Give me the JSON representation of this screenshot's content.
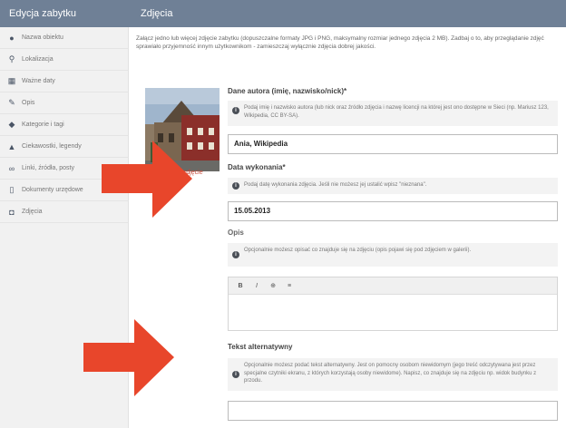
{
  "sidebar": {
    "title": "Edycja zabytku",
    "items": [
      {
        "label": "Nazwa obiektu",
        "icon": "circle-icon"
      },
      {
        "label": "Lokalizacja",
        "icon": "pin-icon"
      },
      {
        "label": "Ważne daty",
        "icon": "calendar-icon"
      },
      {
        "label": "Opis",
        "icon": "edit-icon"
      },
      {
        "label": "Kategorie i tagi",
        "icon": "tag-icon"
      },
      {
        "label": "Ciekawostki, legendy",
        "icon": "pointer-icon"
      },
      {
        "label": "Linki, źródła, posty",
        "icon": "link-icon"
      },
      {
        "label": "Dokumenty urzędowe",
        "icon": "document-icon"
      },
      {
        "label": "Zdjęcia",
        "icon": "camera-icon"
      }
    ]
  },
  "main": {
    "title": "Zdjęcia",
    "intro": "Załącz jedno lub więcej zdjęcie zabytku (dopuszczalne formaty JPG i PNG, maksymalny rozmiar jednego zdjęcia 2 MB). Zadbaj o to, aby przeglądanie zdjęć sprawiało przyjemność innym użytkownikom - zamieszczaj wyłącznie zdjęcia dobrej jakości.",
    "photo_link": "ń zdjęcie"
  },
  "form": {
    "author": {
      "label": "Dane autora (imię, nazwisko/nick)*",
      "hint": "Podaj imię i nazwisko autora (lub nick oraz źródło zdjęcia i nazwę licencji na której jest ono dostępne w Sieci (np. Mariusz 123, Wikipedia, CC BY-SA).",
      "value": "Ania, Wikipedia"
    },
    "date": {
      "label": "Data wykonania*",
      "hint": "Podaj datę wykonania zdjęcia. Jeśli nie możesz jej ustalić wpisz \"nieznana\".",
      "value": "15.05.2013"
    },
    "description": {
      "label": "Opis",
      "hint": "Opcjonalnie możesz opisać co znajduje się na zdjęciu (opis pojawi się pod zdjęciem w galerii).",
      "toolbar": [
        "B",
        "I",
        "⊕",
        "≡"
      ]
    },
    "alt_text": {
      "label": "Tekst alternatywny",
      "hint": "Opcjonalnie możesz podać tekst alternatywny. Jest on pomocny osobom niewidomym (jego treść odczytywana jest przez specjalne czytniki ekranu, z których korzystają osoby niewidome). Napisz, co znajduje się na zdjęciu np. widok budynku z przodu."
    }
  },
  "colors": {
    "header_bg": "#6f8096",
    "arrow": "#e8462b",
    "accent_link": "#c44a3a"
  }
}
